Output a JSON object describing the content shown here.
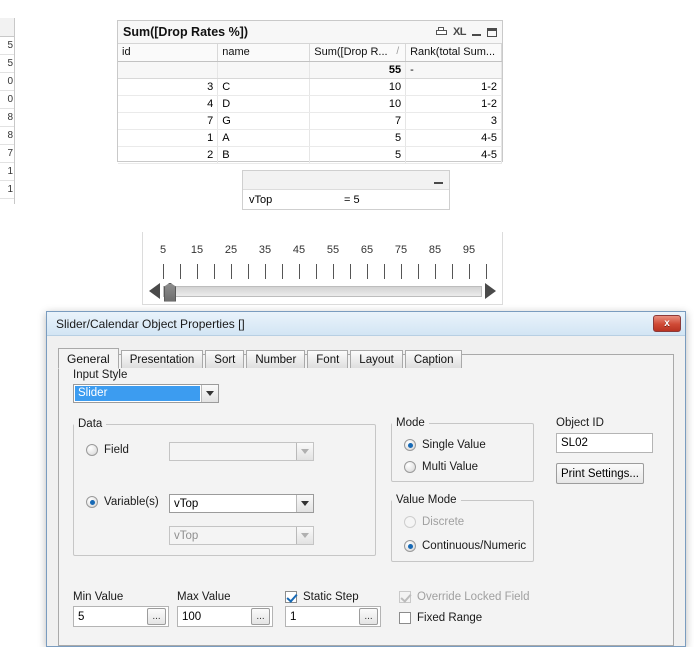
{
  "left_sliver": {
    "rows": [
      "5",
      "5",
      "0",
      "0",
      "8",
      "8",
      "7",
      "1",
      "1"
    ]
  },
  "table_object": {
    "title": "Sum([Drop Rates %])",
    "icons": [
      "print-icon",
      "excel-export-icon",
      "minimize-icon",
      "maximize-icon"
    ],
    "excel_label": "XL",
    "columns": [
      "id",
      "name",
      "Sum([Drop R...",
      "Rank(total Sum..."
    ],
    "sort_indicator": "/",
    "total_row": [
      "",
      "",
      "55",
      "-"
    ],
    "rows": [
      [
        "3",
        "C",
        "10",
        "1-2"
      ],
      [
        "4",
        "D",
        "10",
        "1-2"
      ],
      [
        "7",
        "G",
        "7",
        "3"
      ],
      [
        "1",
        "A",
        "5",
        "4-5"
      ],
      [
        "2",
        "B",
        "5",
        "4-5"
      ]
    ]
  },
  "input_object": {
    "variable": "vTop",
    "equals": "= 5",
    "minimize_icon": "minimize-icon"
  },
  "slider_object": {
    "labels": [
      "5",
      "15",
      "25",
      "35",
      "45",
      "55",
      "65",
      "75",
      "85",
      "95"
    ],
    "tick_count": 20,
    "min": 5,
    "max": 100,
    "value": 5,
    "left_arrow": "arrow-left-icon",
    "right_arrow": "arrow-right-icon"
  },
  "dialog": {
    "title": "Slider/Calendar Object Properties []",
    "close_label": "x",
    "tabs": [
      {
        "label": "General",
        "active": true
      },
      {
        "label": "Presentation",
        "active": false
      },
      {
        "label": "Sort",
        "active": false
      },
      {
        "label": "Number",
        "active": false
      },
      {
        "label": "Font",
        "active": false
      },
      {
        "label": "Layout",
        "active": false
      },
      {
        "label": "Caption",
        "active": false
      }
    ],
    "input_style": {
      "label": "Input Style",
      "value": "Slider"
    },
    "data_group": {
      "legend": "Data",
      "field_label": "Field",
      "field_selected": false,
      "field_value": "",
      "variables_label": "Variable(s)",
      "variables_selected": true,
      "variable_value": "vTop",
      "variable_value_secondary": "vTop"
    },
    "mode_group": {
      "legend": "Mode",
      "single_value": "Single Value",
      "multi_value": "Multi Value",
      "selected": "Single Value"
    },
    "value_mode_group": {
      "legend": "Value Mode",
      "discrete": "Discrete",
      "continuous": "Continuous/Numeric",
      "selected": "Continuous/Numeric"
    },
    "object_id": {
      "label": "Object ID",
      "value": "SL02"
    },
    "print_settings_label": "Print Settings...",
    "min_value": {
      "label": "Min Value",
      "value": "5"
    },
    "max_value": {
      "label": "Max Value",
      "value": "100"
    },
    "static_step": {
      "label": "Static Step",
      "checked": true,
      "value": "1"
    },
    "override_locked_field": {
      "label": "Override Locked Field",
      "checked": true,
      "enabled": false
    },
    "fixed_range": {
      "label": "Fixed Range",
      "checked": false,
      "enabled": true
    },
    "ellipsis_label": "..."
  }
}
